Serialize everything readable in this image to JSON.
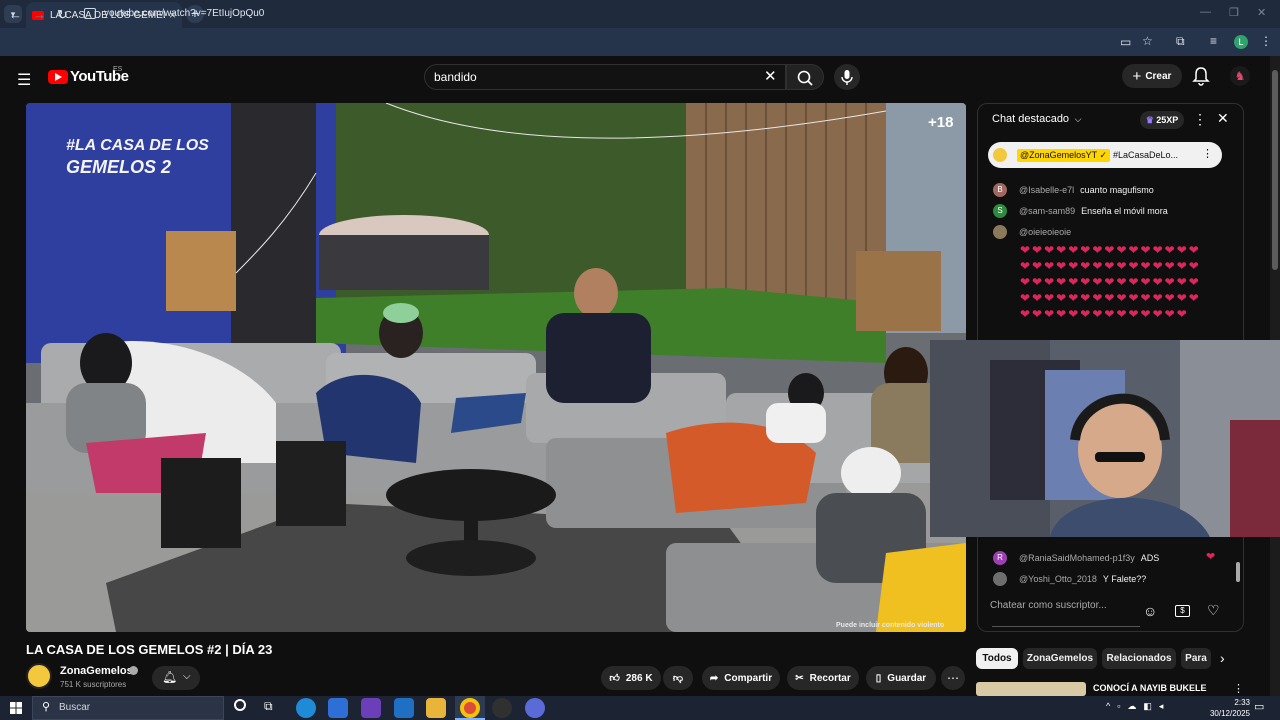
{
  "browser": {
    "tab_title": "LA CASA DE LOS GEMELOS #2 |",
    "url": "youtube.com/watch?v=7EtIujOpQu0",
    "profile_initial": "L"
  },
  "youtube": {
    "logo_text": "YouTube",
    "country": "ES",
    "search_value": "bandido",
    "create_label": "Crear"
  },
  "video": {
    "age_rating": "+18",
    "disclaimer": "Puede incluir contenido violento",
    "title": "LA CASA DE LOS GEMELOS #2 | DÍA 23",
    "channel_name": "ZonaGemelos",
    "subscribers": "751 K suscriptores",
    "likes": "286 K",
    "share_label": "Compartir",
    "clip_label": "Recortar",
    "save_label": "Guardar",
    "logo_text_line1": "#LA CASA DE LOS",
    "logo_text_line2": "GEMELOS 2"
  },
  "chat": {
    "title": "Chat destacado",
    "xp_badge": "25XP",
    "pinned_user": "@ZonaGemelosYT ✓",
    "pinned_message": "#LaCasaDeLo...",
    "messages": [
      {
        "initial": "B",
        "color": "#a1685f",
        "user": "@Isabelle-e7l",
        "text": "cuanto magufismo"
      },
      {
        "initial": "S",
        "color": "#2e8b3e",
        "user": "@sam-sam89",
        "text": "Enseña el móvil mora"
      },
      {
        "initial": "",
        "color": "#8a7a5a",
        "user": "@oieieoieoie",
        "text": ""
      },
      {
        "initial": "R",
        "color": "#9c3fb0",
        "user": "@RaniaSaidMohamed-p1f3y",
        "text": "ADS"
      },
      {
        "initial": "",
        "color": "#6e6e6e",
        "user": "@Yoshi_Otto_2018",
        "text": "Y Falete??"
      }
    ],
    "hearts": "❤❤❤❤❤❤❤❤❤❤❤❤❤❤❤❤❤❤❤❤❤❤❤❤❤❤❤❤❤❤❤❤❤❤❤❤❤❤❤❤❤❤❤❤❤❤❤❤❤❤❤❤❤❤❤❤❤❤❤❤❤❤❤❤❤❤❤❤❤❤❤❤❤❤",
    "rania_heart": "❤",
    "input_placeholder": "Chatear como suscriptor..."
  },
  "chips": [
    {
      "label": "Todos"
    },
    {
      "label": "ZonaGemelos"
    },
    {
      "label": "Relacionados"
    },
    {
      "label": "Para"
    }
  ],
  "recommended": {
    "title": "CONOCÍ A NAYIB BUKELE"
  },
  "taskbar": {
    "search_placeholder": "Buscar",
    "time": "2:33",
    "date": "30/12/2025"
  }
}
